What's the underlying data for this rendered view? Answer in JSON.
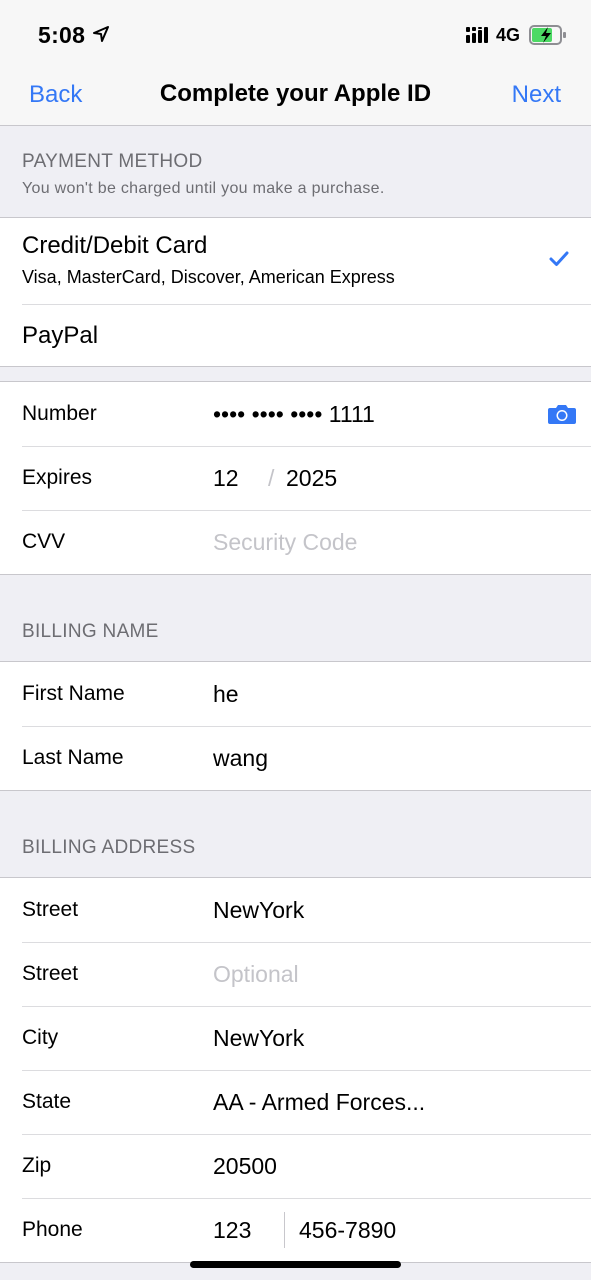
{
  "status_bar": {
    "time": "5:08",
    "network": "4G",
    "icons": [
      "location-icon",
      "signal-icon",
      "battery-charging-icon"
    ]
  },
  "nav": {
    "back_label": "Back",
    "title": "Complete your Apple ID",
    "next_label": "Next"
  },
  "payment_method": {
    "header": "PAYMENT METHOD",
    "subheader": "You won't be charged until you make a purchase.",
    "options": [
      {
        "title": "Credit/Debit Card",
        "subtitle": "Visa, MasterCard, Discover, American Express",
        "selected": true
      },
      {
        "title": "PayPal",
        "selected": false
      }
    ]
  },
  "card": {
    "number_label": "Number",
    "number_value": "•••• •••• •••• 1111",
    "expires_label": "Expires",
    "expires_month": "12",
    "expires_separator": "/",
    "expires_year": "2025",
    "cvv_label": "CVV",
    "cvv_placeholder": "Security Code"
  },
  "billing_name": {
    "header": "BILLING NAME",
    "first_name_label": "First Name",
    "first_name_value": "he",
    "last_name_label": "Last Name",
    "last_name_value": "wang"
  },
  "billing_address": {
    "header": "BILLING ADDRESS",
    "street_label": "Street",
    "street_value": "NewYork",
    "street2_label": "Street",
    "street2_placeholder": "Optional",
    "city_label": "City",
    "city_value": "NewYork",
    "state_label": "State",
    "state_value": "AA - Armed Forces...",
    "zip_label": "Zip",
    "zip_value": "20500",
    "phone_label": "Phone",
    "phone_area": "123",
    "phone_number": "456-7890"
  },
  "colors": {
    "accent": "#3478f6",
    "background": "#efeff4",
    "section_text": "#6d6d72",
    "placeholder": "#c4c4c9"
  }
}
